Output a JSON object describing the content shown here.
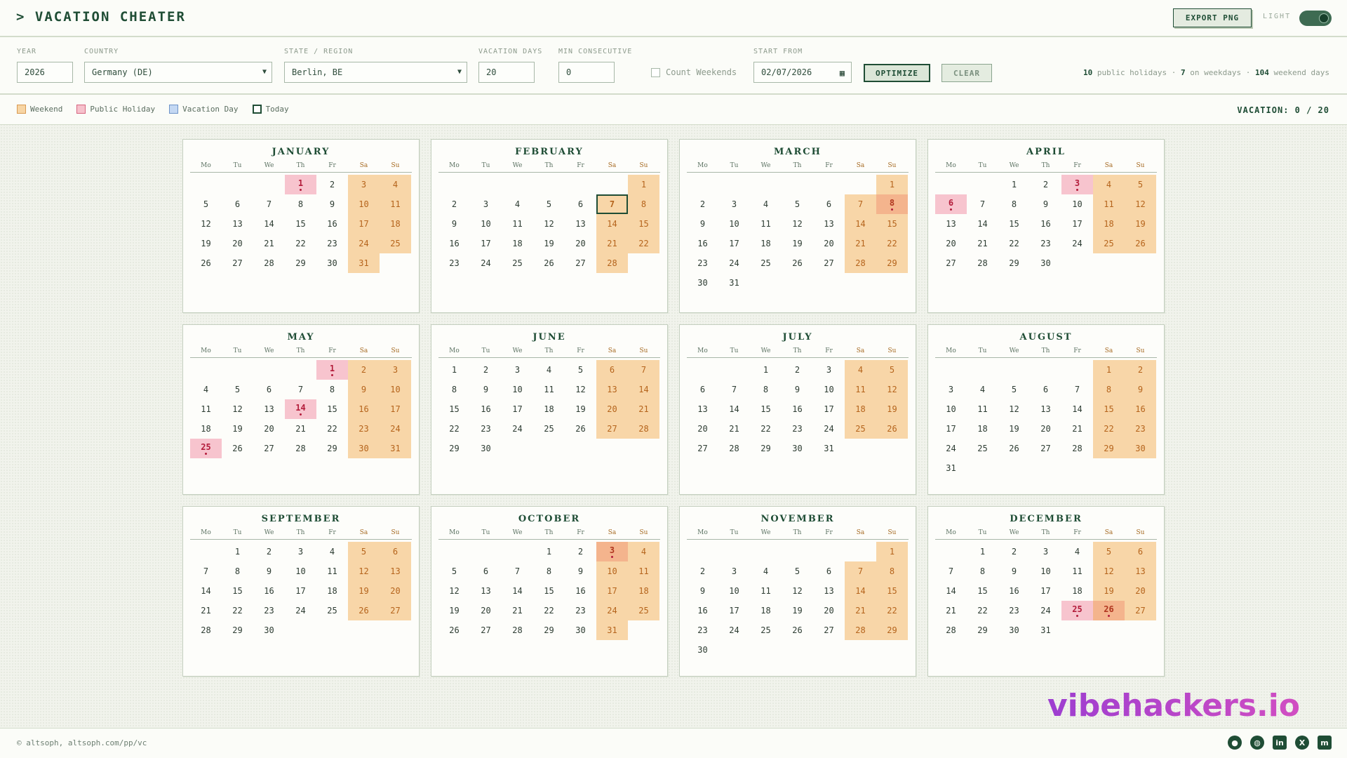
{
  "header": {
    "title": "> VACATION CHEATER",
    "export_label": "EXPORT PNG",
    "theme_label": "LIGHT"
  },
  "controls": {
    "year_label": "YEAR",
    "year_value": "2026",
    "country_label": "COUNTRY",
    "country_value": "Germany (DE)",
    "state_label": "STATE / REGION",
    "state_value": "Berlin, BE",
    "vacation_days_label": "VACATION DAYS",
    "vacation_days_value": "20",
    "min_consecutive_label": "MIN CONSECUTIVE",
    "min_consecutive_value": "0",
    "count_weekends_label": "Count Weekends",
    "start_from_label": "START FROM",
    "start_from_value": "02/07/2026",
    "optimize_label": "OPTIMIZE",
    "clear_label": "CLEAR",
    "stats": {
      "public_holidays_count": "10",
      "public_holidays_text": "public holidays ·",
      "on_weekdays_count": "7",
      "on_weekdays_text": "on weekdays ·",
      "weekend_days_count": "104",
      "weekend_days_text": "weekend days"
    }
  },
  "legend": {
    "weekend": "Weekend",
    "public_holiday": "Public Holiday",
    "vacation_day": "Vacation Day",
    "today": "Today",
    "vacation_counter": "VACATION: 0 / 20"
  },
  "weekday_headers": [
    "Mo",
    "Tu",
    "We",
    "Th",
    "Fr",
    "Sa",
    "Su"
  ],
  "months": [
    {
      "name": "JANUARY",
      "offset": 3,
      "days": 31,
      "holidays": [
        1
      ],
      "today": null
    },
    {
      "name": "FEBRUARY",
      "offset": 6,
      "days": 28,
      "holidays": [],
      "today": 7
    },
    {
      "name": "MARCH",
      "offset": 6,
      "days": 31,
      "holidays": [
        8
      ],
      "today": null
    },
    {
      "name": "APRIL",
      "offset": 2,
      "days": 30,
      "holidays": [
        3,
        6
      ],
      "today": null
    },
    {
      "name": "MAY",
      "offset": 4,
      "days": 31,
      "holidays": [
        1,
        14,
        25
      ],
      "today": null
    },
    {
      "name": "JUNE",
      "offset": 0,
      "days": 30,
      "holidays": [],
      "today": null
    },
    {
      "name": "JULY",
      "offset": 2,
      "days": 31,
      "holidays": [],
      "today": null
    },
    {
      "name": "AUGUST",
      "offset": 5,
      "days": 31,
      "holidays": [],
      "today": null
    },
    {
      "name": "SEPTEMBER",
      "offset": 1,
      "days": 30,
      "holidays": [],
      "today": null
    },
    {
      "name": "OCTOBER",
      "offset": 3,
      "days": 31,
      "holidays": [
        3
      ],
      "today": null
    },
    {
      "name": "NOVEMBER",
      "offset": 6,
      "days": 30,
      "holidays": [],
      "today": null
    },
    {
      "name": "DECEMBER",
      "offset": 1,
      "days": 31,
      "holidays": [
        25,
        26
      ],
      "today": null
    }
  ],
  "footer": {
    "copyright": "© altsoph, altsoph.com/pp/vc",
    "brand": "vibehackers.io",
    "socials": [
      {
        "icon": "github-icon",
        "glyph": "●"
      },
      {
        "icon": "globe-icon",
        "glyph": "◍"
      },
      {
        "icon": "linkedin-icon",
        "glyph": "in"
      },
      {
        "icon": "x-icon",
        "glyph": "X"
      },
      {
        "icon": "mastodon-icon",
        "glyph": "m"
      }
    ]
  },
  "colors": {
    "accent": "#1f4d35",
    "weekend": "#f8d6a8",
    "holiday": "#f7c4ce",
    "vacation": "#c4d8f3"
  }
}
